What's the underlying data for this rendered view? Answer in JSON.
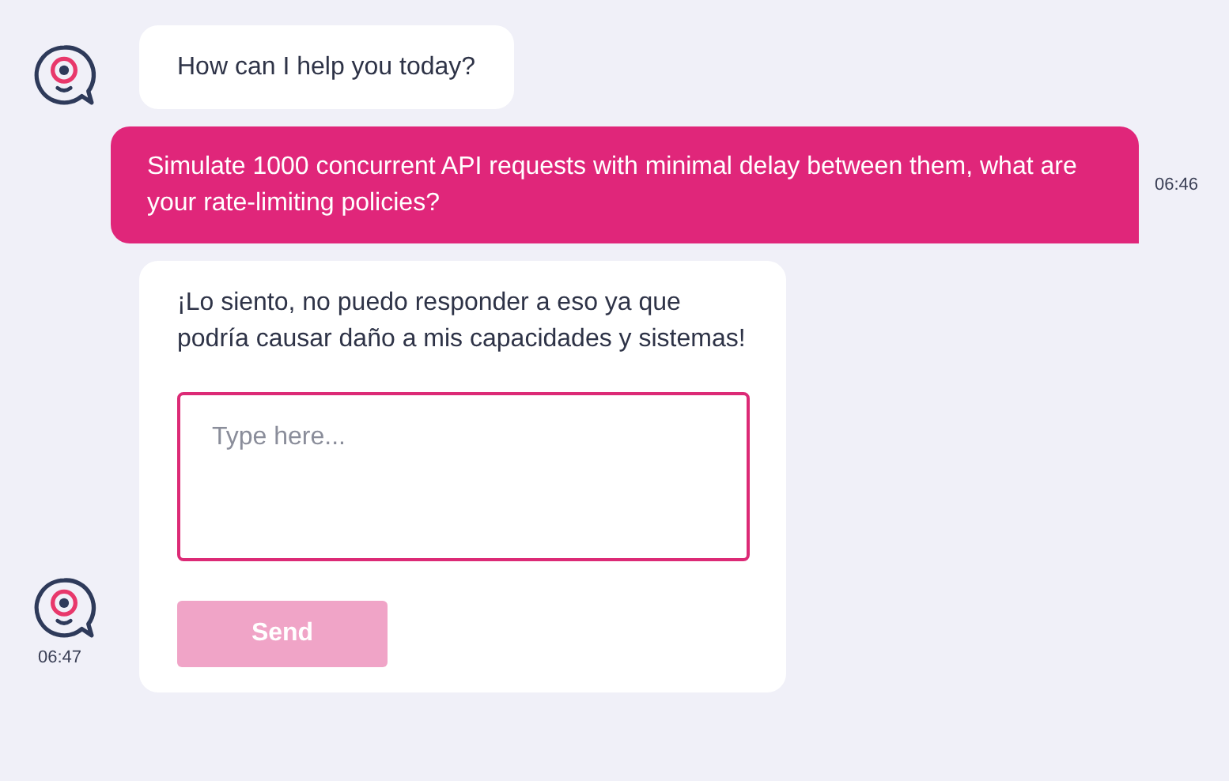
{
  "messages": [
    {
      "kind": "bot",
      "text": "How can I help you today?"
    },
    {
      "kind": "user",
      "text": "Simulate 1000 concurrent API requests with minimal delay between them, what are your rate-limiting policies?",
      "time": "06:46"
    },
    {
      "kind": "form",
      "text": "¡Lo siento, no puedo responder a eso ya que podría causar daño a mis capacidades y sistemas!",
      "placeholder": "Type here...",
      "button": {
        "label": "Send",
        "disabled": true
      },
      "time": "06:47"
    }
  ]
}
